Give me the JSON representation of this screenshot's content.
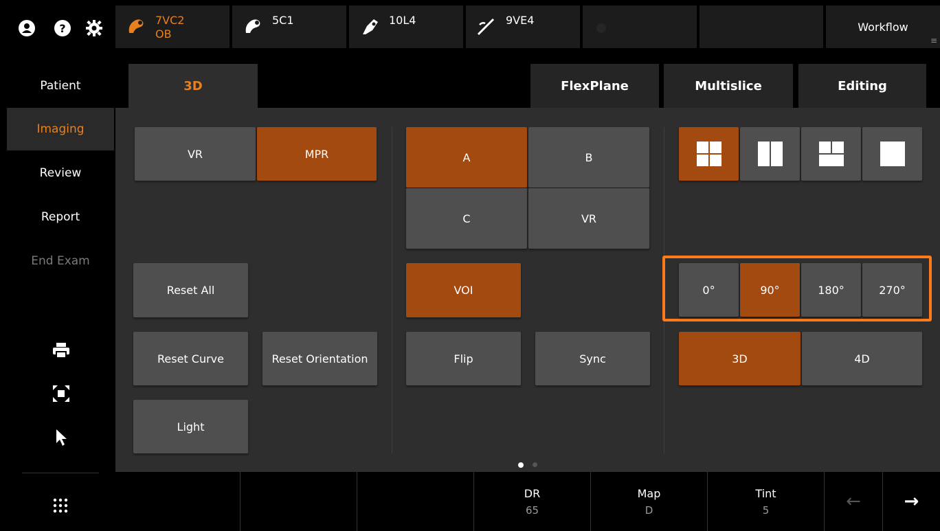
{
  "topbar": {
    "probes": [
      {
        "line1": "7VC2",
        "line2": "OB",
        "active": true
      },
      {
        "line1": "5C1",
        "line2": ""
      },
      {
        "line1": "10L4",
        "line2": ""
      },
      {
        "line1": "9VE4",
        "line2": ""
      }
    ],
    "workflow_label": "Workflow"
  },
  "nav": {
    "items": [
      "Patient",
      "Imaging",
      "Review",
      "Report",
      "End Exam"
    ]
  },
  "tabs": [
    "3D",
    "FlexPlane",
    "Multislice",
    "Editing"
  ],
  "buttons": {
    "vr": "VR",
    "mpr": "MPR",
    "reset_all": "Reset All",
    "reset_curve": "Reset Curve",
    "reset_orientation": "Reset Orientation",
    "light": "Light",
    "a": "A",
    "b": "B",
    "c": "C",
    "vr2": "VR",
    "voi": "VOI",
    "flip": "Flip",
    "sync": "Sync",
    "rot0": "0°",
    "rot90": "90°",
    "rot180": "180°",
    "rot270": "270°",
    "mode3d": "3D",
    "mode4d": "4D"
  },
  "bottom": {
    "dr_label": "DR",
    "dr_value": "65",
    "map_label": "Map",
    "map_value": "D",
    "tint_label": "Tint",
    "tint_value": "5",
    "prev_arrow": "←",
    "next_arrow": "→"
  },
  "colors": {
    "accent": "#e8801f",
    "active_btn": "#a34a11",
    "highlight_border": "#ff7a1a"
  }
}
